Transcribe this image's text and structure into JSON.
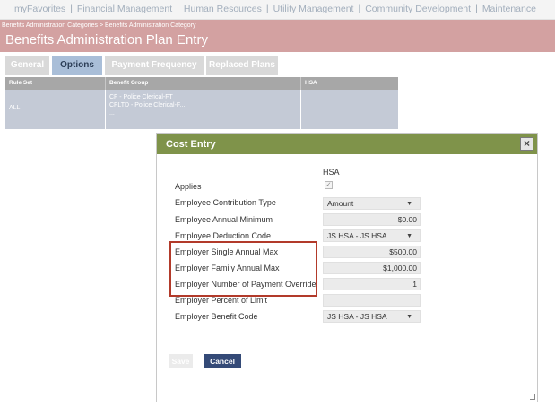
{
  "topnav": {
    "items": [
      "myFavorites",
      "Financial Management",
      "Human Resources",
      "Utility Management",
      "Community Development",
      "Maintenance"
    ],
    "separator": "|"
  },
  "header": {
    "breadcrumb": "Benefits Administration Categories > Benefits Administration Category",
    "title": "Benefits Administration Plan Entry"
  },
  "tabs": [
    "General",
    "Options",
    "Payment Frequency",
    "Replaced Plans"
  ],
  "grid": {
    "headers": [
      "Rule Set",
      "Benefit Group",
      "",
      "HSA"
    ],
    "row": {
      "rule_set": "ALL",
      "benefit_group": [
        "CF - Police Clerical-FT",
        "CFLTD - Police Clerical-F...",
        "..."
      ]
    }
  },
  "dialog": {
    "title": "Cost Entry",
    "close_label": "×",
    "column_header": "HSA",
    "fields": {
      "applies": {
        "label": "Applies",
        "checked": true,
        "glyph": "✓"
      },
      "employee_contribution_type": {
        "label": "Employee Contribution Type",
        "value": "Amount"
      },
      "employee_annual_minimum": {
        "label": "Employee Annual Minimum",
        "value": "$0.00"
      },
      "employee_deduction_code": {
        "label": "Employee Deduction Code",
        "value": "JS HSA - JS HSA"
      },
      "employer_single_annual_max": {
        "label": "Employer Single Annual Max",
        "value": "$500.00"
      },
      "employer_family_annual_max": {
        "label": "Employer Family Annual Max",
        "value": "$1,000.00"
      },
      "employer_number_of_payment_override": {
        "label": "Employer Number of Payment Override",
        "value": "1"
      },
      "employer_percent_of_limit": {
        "label": "Employer Percent of Limit",
        "value": ""
      },
      "employer_benefit_code": {
        "label": "Employer Benefit Code",
        "value": "JS HSA - JS HSA"
      }
    },
    "select_arrow": "▼",
    "buttons": {
      "save": "Save",
      "cancel": "Cancel"
    }
  },
  "colors": {
    "header_bg": "#d3a1a1",
    "dialog_title_bg": "#7f934a",
    "cancel_button": "#344a77",
    "active_tab": "#a9bed8",
    "highlight_border": "#b23a2a"
  }
}
